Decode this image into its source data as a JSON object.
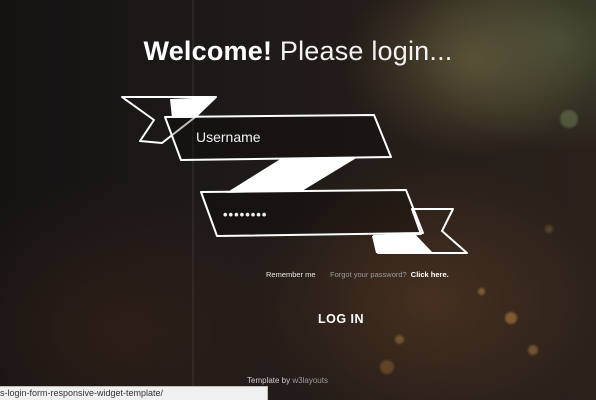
{
  "heading": {
    "bold": "Welcome!",
    "light": "Please login..."
  },
  "form": {
    "username_placeholder": "Username",
    "password_value": "••••••••",
    "remember_me": "Remember me",
    "forgot_text": "Forgot your password?",
    "click_here": "Click here.",
    "login_button": "LOG IN"
  },
  "footer": {
    "prefix": "Template by",
    "link": "w3layouts"
  },
  "status_bar": {
    "url": "s-login-form-responsive-widget-template/"
  },
  "colors": {
    "ribbon": "#ffffff",
    "background": "#1a1716",
    "text": "#ffffff"
  }
}
